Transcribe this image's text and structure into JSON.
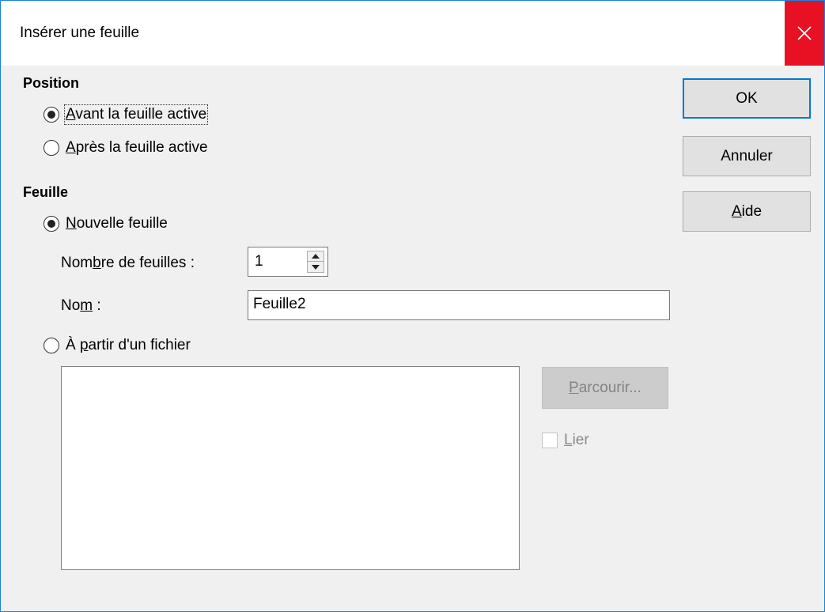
{
  "window": {
    "title": "Insérer une feuille",
    "close_icon": "close-icon"
  },
  "position": {
    "heading": "Position",
    "before": {
      "prefix": "",
      "accel": "A",
      "rest": "vant la feuille active",
      "checked": true
    },
    "after": {
      "prefix": "",
      "accel": "A",
      "rest": "près la feuille active",
      "checked": false
    }
  },
  "sheet": {
    "heading": "Feuille",
    "new_sheet": {
      "prefix": "",
      "accel": "N",
      "rest": "ouvelle feuille",
      "checked": true
    },
    "count": {
      "label_prefix": "Nom",
      "label_accel": "b",
      "label_rest": "re de feuilles :",
      "value": "1"
    },
    "name": {
      "label_prefix": "No",
      "label_accel": "m",
      "label_rest": " :",
      "value": "Feuille2"
    },
    "from_file": {
      "prefix": "À ",
      "accel": "p",
      "rest": "artir d'un fichier",
      "checked": false
    }
  },
  "buttons": {
    "ok": "OK",
    "cancel": "Annuler",
    "help_accel": "A",
    "help_rest": "ide",
    "browse_accel": "P",
    "browse_rest": "arcourir...",
    "link_accel": "L",
    "link_rest": "ier"
  },
  "colors": {
    "accent": "#0078d7",
    "close_bg": "#e81123"
  }
}
